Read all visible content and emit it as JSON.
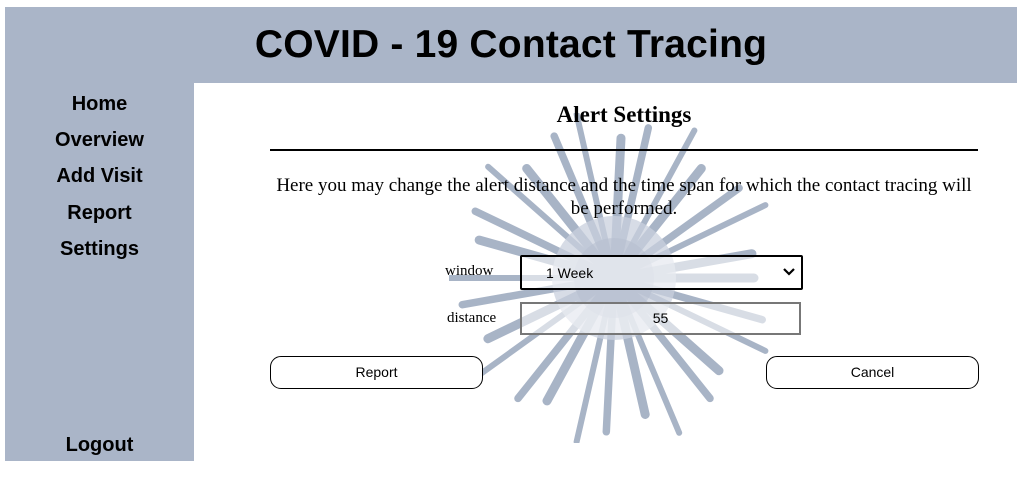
{
  "header": {
    "title": "COVID - 19 Contact Tracing"
  },
  "sidebar": {
    "items": [
      {
        "label": "Home"
      },
      {
        "label": "Overview"
      },
      {
        "label": "Add Visit"
      },
      {
        "label": "Report"
      },
      {
        "label": "Settings"
      }
    ],
    "logout_label": "Logout"
  },
  "main": {
    "title": "Alert Settings",
    "description": "Here you may change the alert distance and the time span for which the contact tracing will be performed.",
    "window": {
      "label": "window",
      "value": "1 Week"
    },
    "distance": {
      "label": "distance",
      "value": "55"
    },
    "report_label": "Report",
    "cancel_label": "Cancel",
    "background_icon": "coronavirus-illustration"
  },
  "colors": {
    "header_bg": "#aab5c8",
    "sidebar_bg": "#aab5c8",
    "content_bg": "#ffffff"
  }
}
